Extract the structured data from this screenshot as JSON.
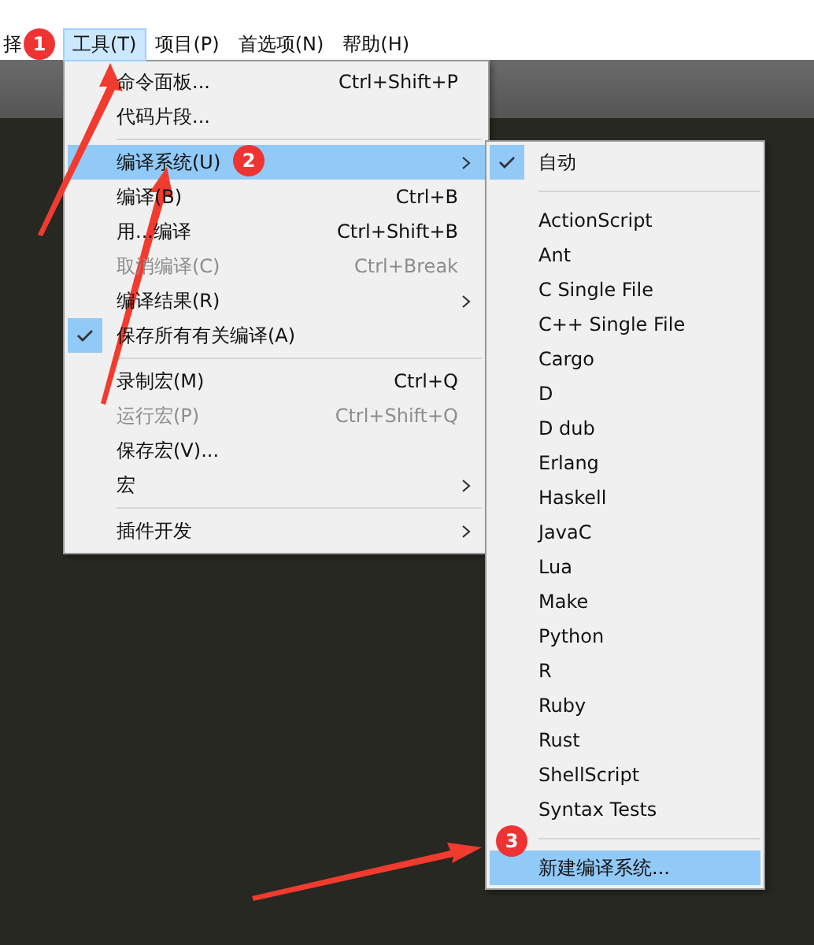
{
  "menubar": [
    {
      "label": "择",
      "selected": false
    },
    {
      "label": "工具(T)",
      "selected": true
    },
    {
      "label": "项目(P)",
      "selected": false
    },
    {
      "label": "首选项(N)",
      "selected": false
    },
    {
      "label": "帮助(H)",
      "selected": false
    }
  ],
  "menu": [
    {
      "kind": "item",
      "label": "命令面板...",
      "shortcut": "Ctrl+Shift+P",
      "submenu": false,
      "checked": false,
      "disabled": false,
      "selected": false
    },
    {
      "kind": "item",
      "label": "代码片段...",
      "submenu": false,
      "checked": false,
      "disabled": false,
      "selected": false
    },
    {
      "kind": "separator"
    },
    {
      "kind": "item",
      "label": "编译系统(U)",
      "submenu": true,
      "checked": false,
      "disabled": false,
      "selected": true
    },
    {
      "kind": "item",
      "label": "编译(B)",
      "shortcut": "Ctrl+B",
      "submenu": false,
      "checked": false,
      "disabled": false,
      "selected": false
    },
    {
      "kind": "item",
      "label": "用...编译",
      "shortcut": "Ctrl+Shift+B",
      "submenu": false,
      "checked": false,
      "disabled": false,
      "selected": false
    },
    {
      "kind": "item",
      "label": "取消编译(C)",
      "shortcut": "Ctrl+Break",
      "submenu": false,
      "checked": false,
      "disabled": true,
      "selected": false
    },
    {
      "kind": "item",
      "label": "编译结果(R)",
      "submenu": true,
      "checked": false,
      "disabled": false,
      "selected": false
    },
    {
      "kind": "item",
      "label": "保存所有有关编译(A)",
      "submenu": false,
      "checked": true,
      "disabled": false,
      "selected": false
    },
    {
      "kind": "separator"
    },
    {
      "kind": "item",
      "label": "录制宏(M)",
      "shortcut": "Ctrl+Q",
      "submenu": false,
      "checked": false,
      "disabled": false,
      "selected": false
    },
    {
      "kind": "item",
      "label": "运行宏(P)",
      "shortcut": "Ctrl+Shift+Q",
      "submenu": false,
      "checked": false,
      "disabled": true,
      "selected": false
    },
    {
      "kind": "item",
      "label": "保存宏(V)...",
      "submenu": false,
      "checked": false,
      "disabled": false,
      "selected": false
    },
    {
      "kind": "item",
      "label": "宏",
      "submenu": true,
      "checked": false,
      "disabled": false,
      "selected": false
    },
    {
      "kind": "separator"
    },
    {
      "kind": "item",
      "label": "插件开发",
      "submenu": true,
      "checked": false,
      "disabled": false,
      "selected": false
    }
  ],
  "submenu": [
    {
      "kind": "item",
      "label": "自动",
      "checked": true,
      "selected": false
    },
    {
      "kind": "separator"
    },
    {
      "kind": "item",
      "label": "ActionScript",
      "checked": false,
      "selected": false
    },
    {
      "kind": "item",
      "label": "Ant",
      "checked": false,
      "selected": false
    },
    {
      "kind": "item",
      "label": "C Single File",
      "checked": false,
      "selected": false
    },
    {
      "kind": "item",
      "label": "C++ Single File",
      "checked": false,
      "selected": false
    },
    {
      "kind": "item",
      "label": "Cargo",
      "checked": false,
      "selected": false
    },
    {
      "kind": "item",
      "label": "D",
      "checked": false,
      "selected": false
    },
    {
      "kind": "item",
      "label": "D dub",
      "checked": false,
      "selected": false
    },
    {
      "kind": "item",
      "label": "Erlang",
      "checked": false,
      "selected": false
    },
    {
      "kind": "item",
      "label": "Haskell",
      "checked": false,
      "selected": false
    },
    {
      "kind": "item",
      "label": "JavaC",
      "checked": false,
      "selected": false
    },
    {
      "kind": "item",
      "label": "Lua",
      "checked": false,
      "selected": false
    },
    {
      "kind": "item",
      "label": "Make",
      "checked": false,
      "selected": false
    },
    {
      "kind": "item",
      "label": "Python",
      "checked": false,
      "selected": false
    },
    {
      "kind": "item",
      "label": "R",
      "checked": false,
      "selected": false
    },
    {
      "kind": "item",
      "label": "Ruby",
      "checked": false,
      "selected": false
    },
    {
      "kind": "item",
      "label": "Rust",
      "checked": false,
      "selected": false
    },
    {
      "kind": "item",
      "label": "ShellScript",
      "checked": false,
      "selected": false
    },
    {
      "kind": "item",
      "label": "Syntax Tests",
      "checked": false,
      "selected": false
    },
    {
      "kind": "separator"
    },
    {
      "kind": "item",
      "label": "新建编译系统...",
      "checked": false,
      "selected": true
    }
  ],
  "badges": [
    "1",
    "2",
    "3"
  ]
}
